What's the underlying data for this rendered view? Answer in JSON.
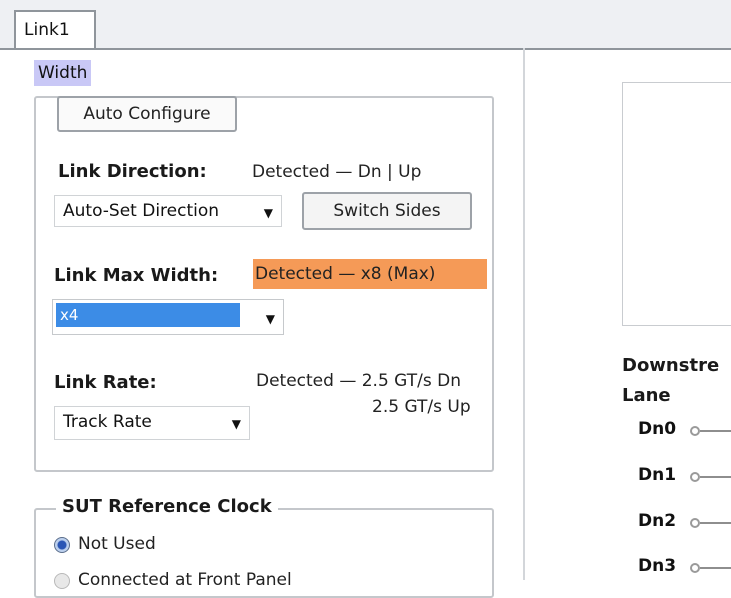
{
  "tabs": {
    "active_label": "Link1"
  },
  "width_section": {
    "label": "Width",
    "auto_configure_label": "Auto Configure",
    "link_direction": {
      "label": "Link Direction:",
      "detected": "Detected — Dn | Up",
      "select_value": "Auto-Set Direction",
      "switch_label": "Switch Sides"
    },
    "link_max_width": {
      "label": "Link Max Width:",
      "detected": "Detected — x8 (Max)",
      "select_value": "x4"
    },
    "link_rate": {
      "label": "Link Rate:",
      "detected_line1": "Detected — 2.5 GT/s Dn",
      "detected_line2": "2.5 GT/s Up",
      "select_value": "Track Rate"
    }
  },
  "sut_clock": {
    "title": "SUT Reference Clock",
    "options": [
      {
        "label": "Not Used",
        "selected": true
      },
      {
        "label": "Connected at Front Panel",
        "selected": false
      }
    ]
  },
  "downstream": {
    "header": "Downstre",
    "lane_header": "Lane",
    "lanes": [
      "Dn0",
      "Dn1",
      "Dn2",
      "Dn3"
    ]
  },
  "colors": {
    "highlight": "#f59a57",
    "selection": "#3c8ce6",
    "width_badge": "#c9c8f6"
  }
}
